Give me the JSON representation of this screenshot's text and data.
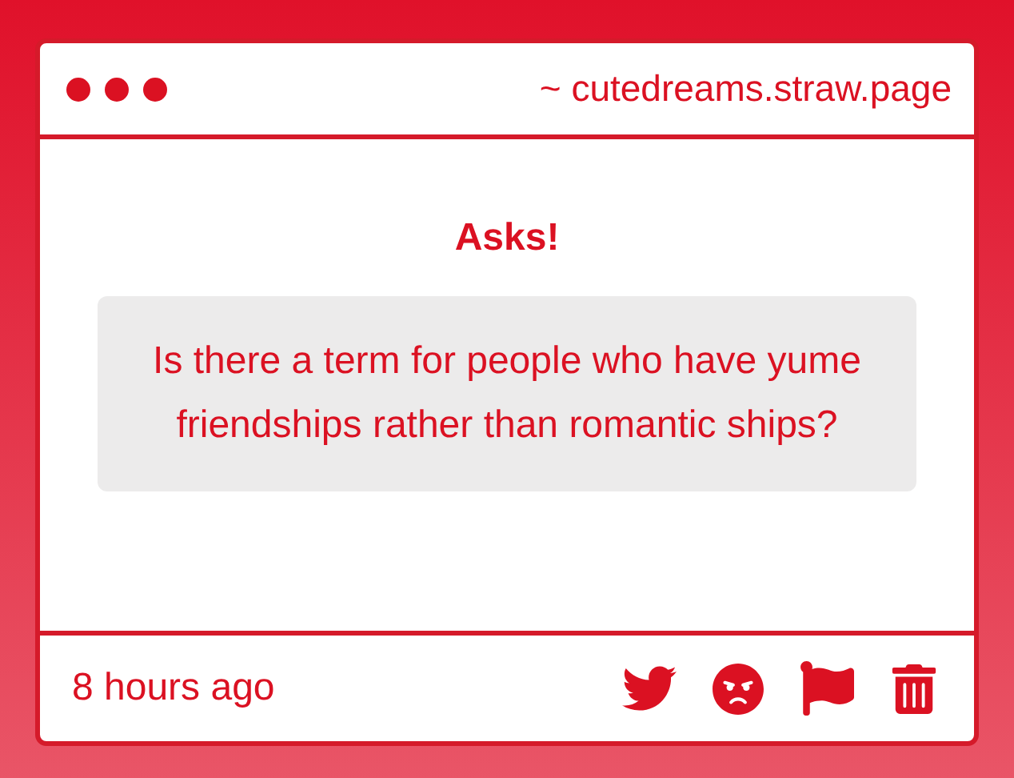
{
  "window": {
    "title": "~ cutedreams.straw.page"
  },
  "heading": "Asks!",
  "question": "Is there a term for people who have yume friendships rather than romantic ships?",
  "footer": {
    "time": "8 hours ago",
    "actions": [
      {
        "kind": "share"
      },
      {
        "kind": "react"
      },
      {
        "kind": "report"
      },
      {
        "kind": "delete"
      }
    ]
  }
}
